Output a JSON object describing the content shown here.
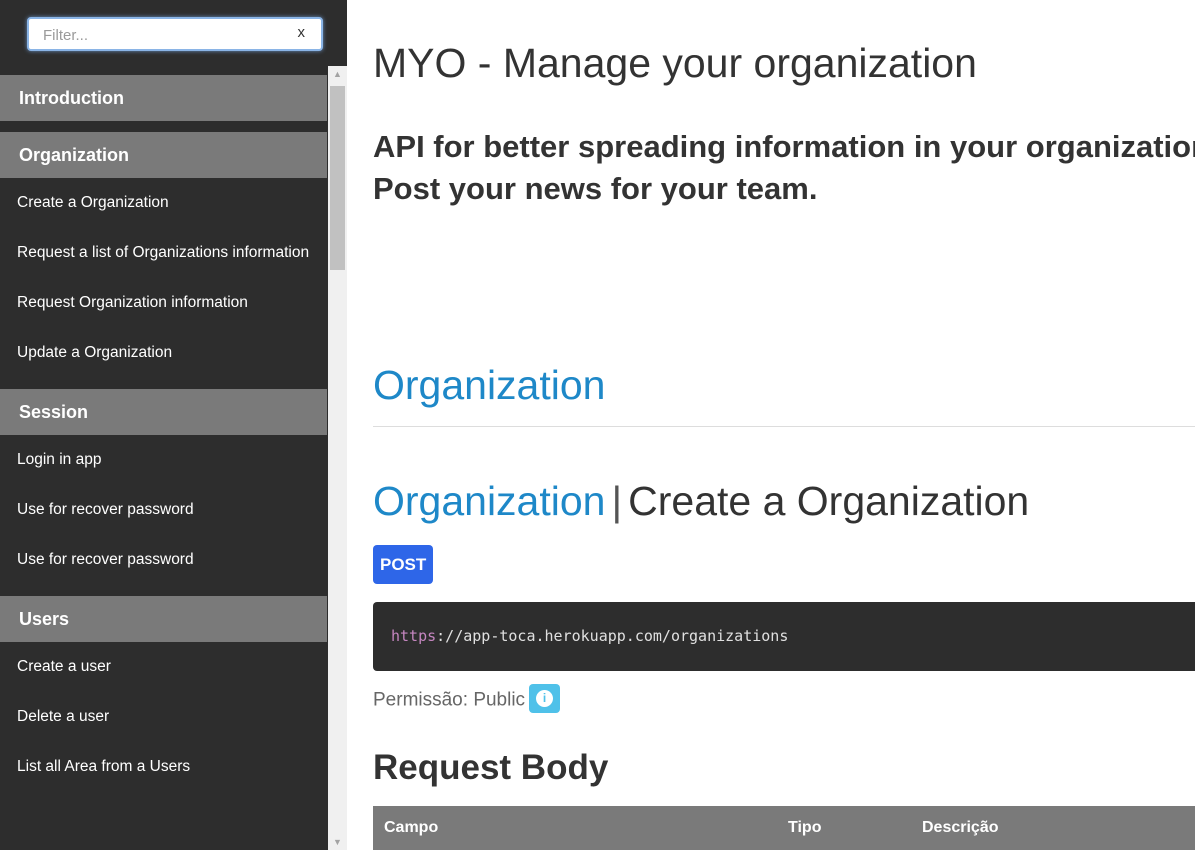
{
  "sidebar": {
    "filter_placeholder": "Filter...",
    "filter_clear": "x",
    "sections": [
      {
        "title": "Introduction",
        "items": []
      },
      {
        "title": "Organization",
        "items": [
          "Create a Organization",
          "Request a list of Organizations information",
          "Request Organization information",
          "Update a Organization"
        ]
      },
      {
        "title": "Session",
        "items": [
          "Login in app",
          "Use for recover password",
          "Use for recover password"
        ]
      },
      {
        "title": "Users",
        "items": [
          "Create a user",
          "Delete a user",
          "List all Area from a Users"
        ]
      }
    ]
  },
  "main": {
    "title": "MYO - Manage your organization",
    "subtitle": "API for better spreading information in your organization. Post your news for your team.",
    "section_title": "Organization",
    "endpoint": {
      "group": "Organization",
      "separator": "|",
      "name": "Create a Organization",
      "method": "POST",
      "url_scheme": "https",
      "url_rest": "://app-toca.herokuapp.com/organizations",
      "permission_label": "Permissão:",
      "permission_value": "Public",
      "info_icon_glyph": "i"
    },
    "request_body_title": "Request Body",
    "table_headers": [
      "Campo",
      "Tipo",
      "Descrição"
    ]
  },
  "colors": {
    "sidebar_bg": "#2d2d2d",
    "sidebar_header_bg": "#7a7a7a",
    "link_blue": "#1e88c8",
    "method_post": "#2e66e8",
    "info_badge": "#4fc1e9"
  }
}
